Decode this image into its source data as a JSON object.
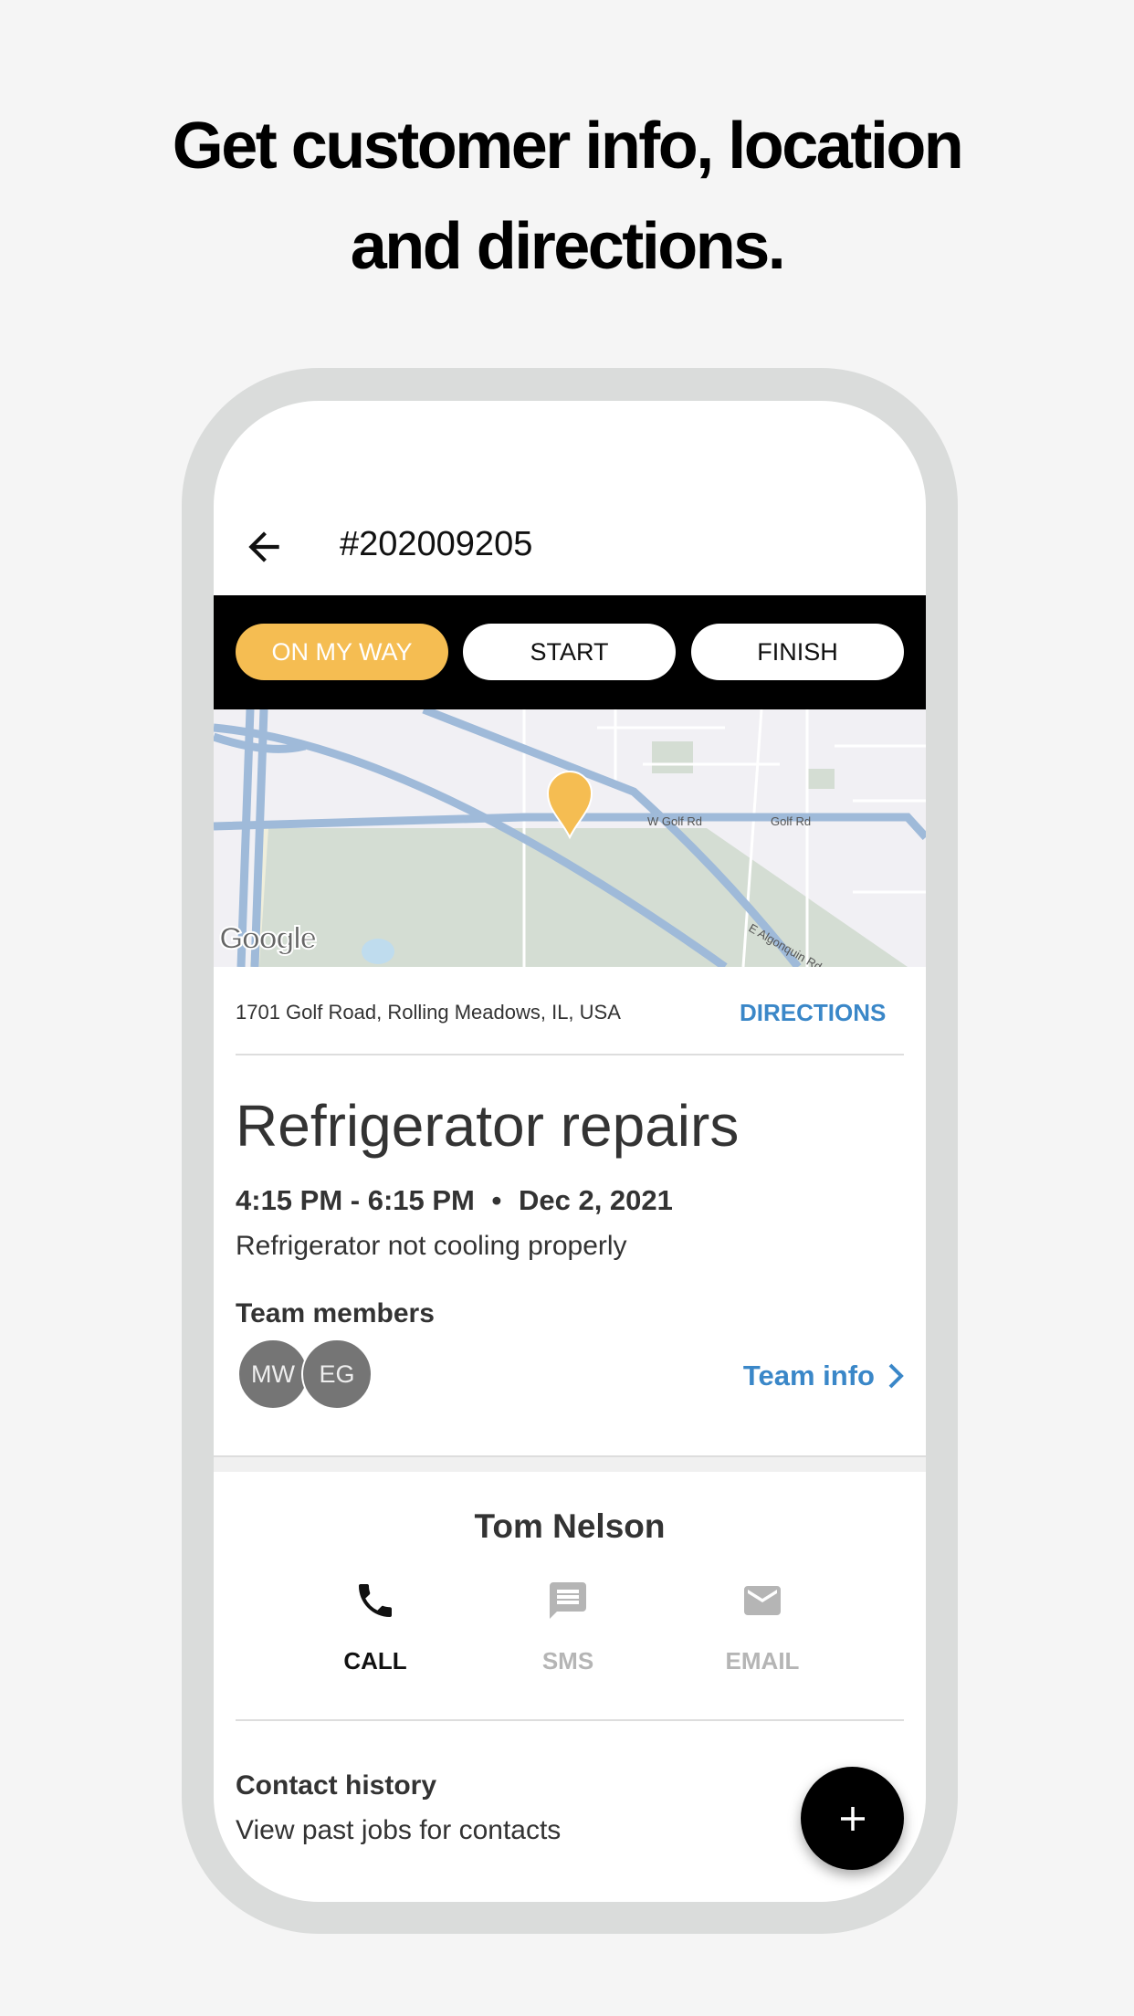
{
  "headline": {
    "line1": "Get customer info, location",
    "line2": "and directions."
  },
  "header": {
    "job_number": "#202009205"
  },
  "status_buttons": [
    {
      "label": "ON MY WAY",
      "active": true
    },
    {
      "label": "START",
      "active": false
    },
    {
      "label": "FINISH",
      "active": false
    }
  ],
  "map": {
    "roads": [
      "W Golf Rd",
      "Golf Rd",
      "E Algonquin Rd"
    ],
    "logo": "Google"
  },
  "address": {
    "text": "1701 Golf Road, Rolling Meadows, IL, USA",
    "directions_label": "DIRECTIONS"
  },
  "job": {
    "title": "Refrigerator repairs",
    "time": "4:15 PM - 6:15 PM",
    "separator": "•",
    "date": "Dec 2, 2021",
    "description": "Refrigerator not cooling properly"
  },
  "team": {
    "label": "Team members",
    "members": [
      "MW",
      "EG"
    ],
    "info_label": "Team info"
  },
  "contact": {
    "name": "Tom Nelson",
    "actions": [
      {
        "label": "CALL",
        "icon": "phone-icon",
        "enabled": true
      },
      {
        "label": "SMS",
        "icon": "message-icon",
        "enabled": false
      },
      {
        "label": "EMAIL",
        "icon": "email-icon",
        "enabled": false
      }
    ]
  },
  "history": {
    "title": "Contact history",
    "subtitle": "View past jobs for contacts"
  },
  "colors": {
    "accent": "#f5bd52",
    "link": "#3a87c8",
    "disabled": "#b5b5b5"
  }
}
